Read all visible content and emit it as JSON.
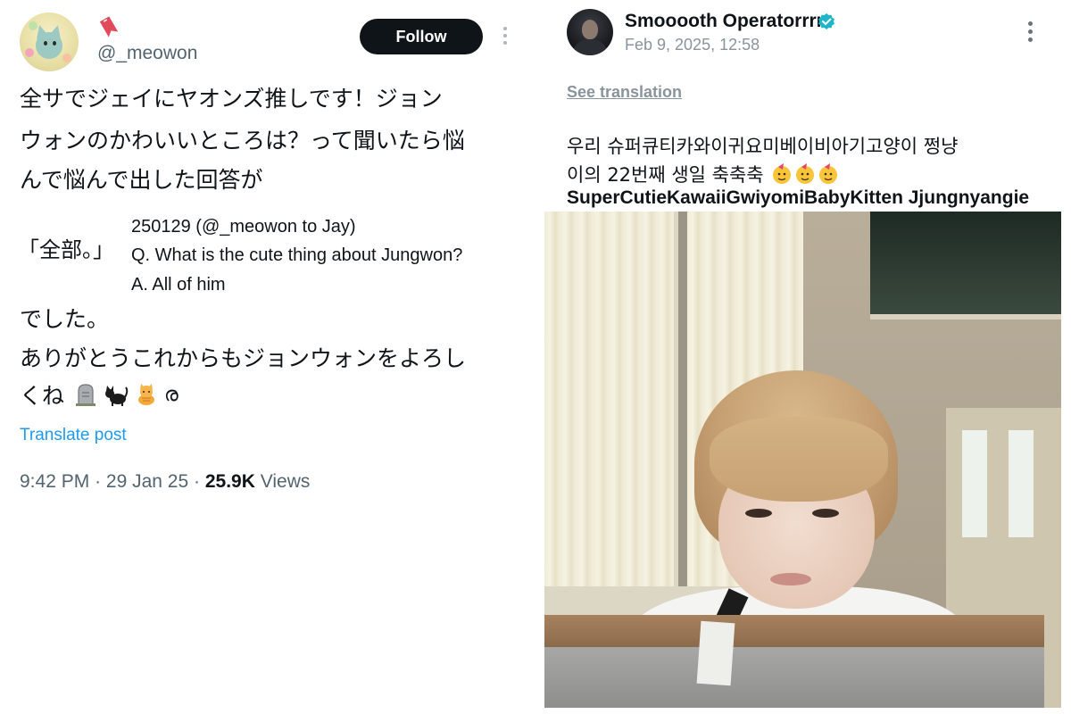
{
  "left_post": {
    "handle": "@_meowon",
    "follow_label": "Follow",
    "text_lines": [
      "全サでジェイにヤオンズ推しです！ジョン",
      "ウォンのかわいいところは？って聞いたら悩",
      "んで悩んで出した回答が"
    ],
    "answer_jp": "「全部。」",
    "caption_lines": [
      "250129 (@_meowon to Jay)",
      "Q. What is the cute thing about Jungwon?",
      "A. All of him"
    ],
    "after_lines": [
      "でした。",
      "ありがとうこれからもジョンウォンをよろし",
      "くね"
    ],
    "emoji_tail": "ര",
    "translate_label": "Translate post",
    "time": "9:42 PM",
    "date": "29 Jan 25",
    "views_count": "25.9K",
    "views_label": "Views",
    "separator": "·"
  },
  "right_post": {
    "name": "Smooooth Operatorrrr",
    "date": "Feb 9, 2025, 12:58",
    "see_translation": "See translation",
    "kr_line1": "우리 슈퍼큐티카와이귀요미베이비아기고양이 쩡냥",
    "kr_line2": "이의 22번째 생일 축축축",
    "en_line": "SuperCutieKawaiiGwiyomiBabyKitten Jjungnyangie"
  },
  "icons": {
    "verified_color": "#1d9bf0",
    "accent": "#1d9bf0"
  }
}
